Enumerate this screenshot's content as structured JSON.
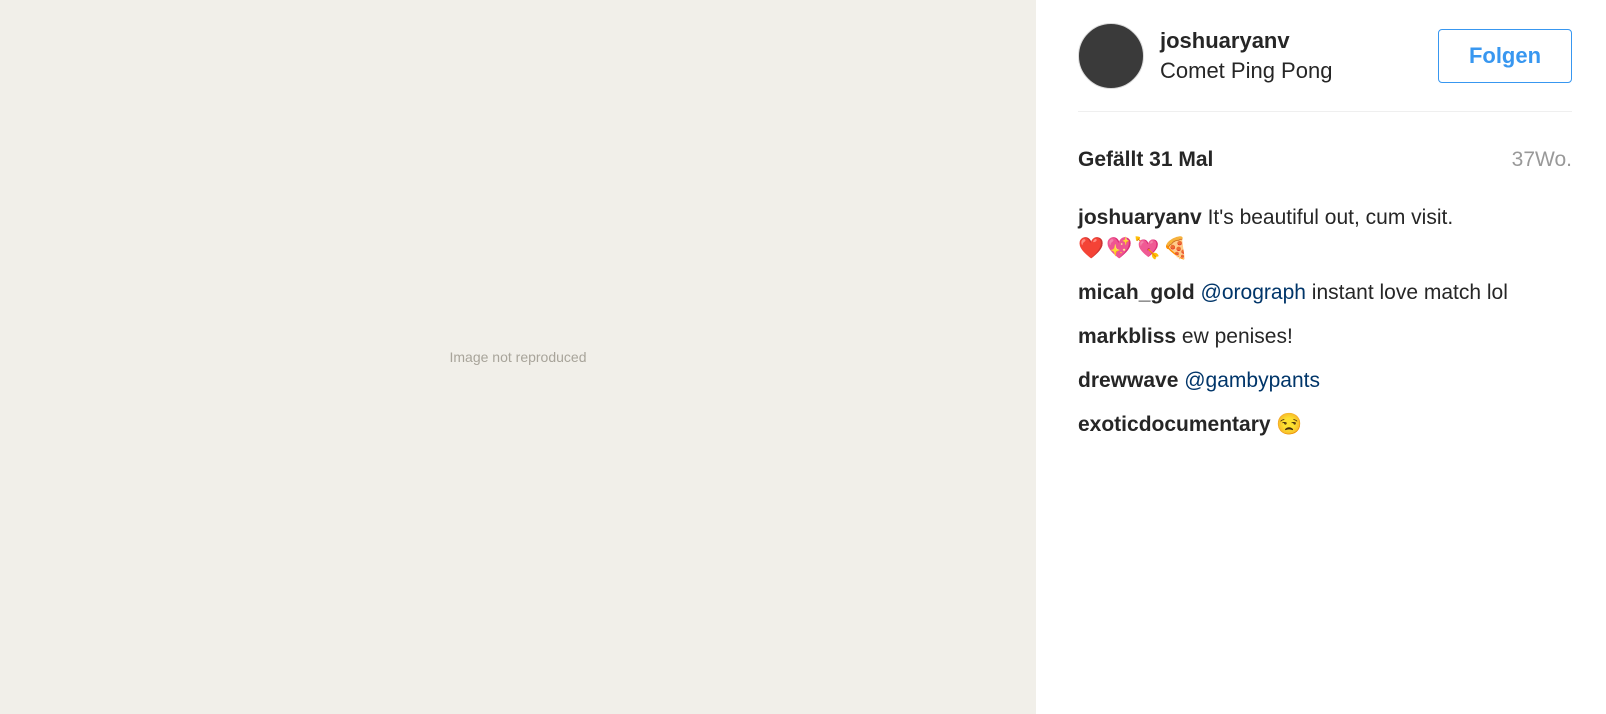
{
  "media": {
    "placeholder": "Image not reproduced"
  },
  "header": {
    "username": "joshuaryanv",
    "location": "Comet Ping Pong",
    "follow_label": "Folgen"
  },
  "meta": {
    "likes": "Gefällt 31 Mal",
    "age": "37Wo."
  },
  "comments": [
    {
      "user": "joshuaryanv",
      "text": "It's beautiful out, cum visit.",
      "emoji": "❤️💖💘🍕"
    },
    {
      "user": "micah_gold",
      "mention": "@orograph",
      "text": "instant love match lol"
    },
    {
      "user": "markbliss",
      "text": "ew penises!"
    },
    {
      "user": "drewwave",
      "mention": "@gambypants",
      "text": ""
    },
    {
      "user": "exoticdocumentary",
      "text": "😒"
    }
  ],
  "colors": {
    "accent": "#3897f0",
    "mention": "#003569",
    "text": "#262626",
    "muted": "#999999"
  }
}
